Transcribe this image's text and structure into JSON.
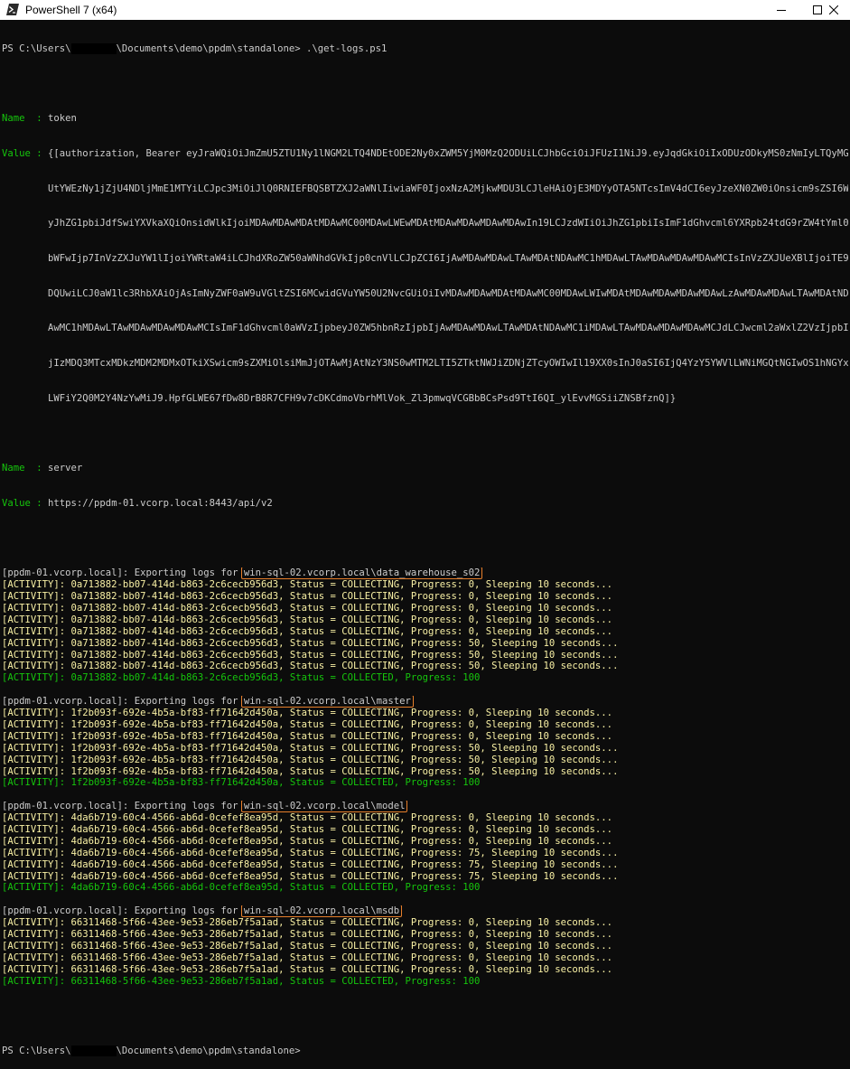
{
  "window": {
    "title": "PowerShell 7 (x64)",
    "icon": "powershell-icon",
    "controls": [
      "minimize-icon",
      "maximize-icon",
      "close-icon"
    ]
  },
  "prompt": {
    "pre": "PS C:\\Users\\",
    "post": "\\Documents\\demo\\ppdm\\standalone>",
    "command": " .\\get-logs.ps1"
  },
  "token": {
    "name_label": "Name  : ",
    "name_value": "token",
    "value_label": "Value : ",
    "value_lines": [
      "{[authorization, Bearer eyJraWQiOiJmZmU5ZTU1Ny1lNGM2LTQ4NDEtODE2Ny0xZWM5YjM0MzQ2ODUiLCJhbGciOiJFUzI1NiJ9.eyJqdGkiOiIxODUzODkyMS0zNmIyLTQyMG",
      "UtYWEzNy1jZjU4NDljMmE1MTYiLCJpc3MiOiJlQ0RNIEFBQSBTZXJ2aWNlIiwiaWF0IjoxNzA2MjkwMDU3LCJleHAiOjE3MDYyOTA5NTcsImV4dCI6eyJzeXN0ZW0iOnsicm9sZSI6W",
      "yJhZG1pbiJdfSwiYXVkaXQiOnsidWlkIjoiMDAwMDAwMDAtMDAwMC00MDAwLWEwMDAtMDAwMDAwMDAwMDAwIn19LCJzdWIiOiJhZG1pbiIsImF1dGhvcml6YXRpb24tdG9rZW4tYml0",
      "bWFwIjp7InVzZXJuYW1lIjoiYWRtaW4iLCJhdXRoZW50aWNhdGVkIjp0cnVlLCJpZCI6IjAwMDAwMDAwLTAwMDAtNDAwMC1hMDAwLTAwMDAwMDAwMDAwMCIsInVzZXJUeXBlIjoiTE9",
      "DQUwiLCJ0aW1lc3RhbXAiOjAsImNyZWF0aW9uVGltZSI6MCwidGVuYW50U2NvcGUiOiIvMDAwMDAwMDAtMDAwMC00MDAwLWIwMDAtMDAwMDAwMDAwMDAwLzAwMDAwMDAwLTAwMDAtND",
      "AwMC1hMDAwLTAwMDAwMDAwMDAwMCIsImF1dGhvcml0aWVzIjpbeyJ0ZW5hbnRzIjpbIjAwMDAwMDAwLTAwMDAtNDAwMC1iMDAwLTAwMDAwMDAwMDAwMCJdLCJwcml2aWxlZ2VzIjpbI",
      "jIzMDQ3MTcxMDkzMDM2MDMxOTkiXSwicm9sZXMiOlsiMmJjOTAwMjAtNzY3NS0wMTM2LTI5ZTktNWJiZDNjZTcyOWIwIl19XX0sInJ0aSI6IjQ4YzY5YWVlLWNiMGQtNGIwOS1hNGYx",
      "LWFiY2Q0M2Y4NzYwMiJ9.HpfGLWE67fDw8DrB8R7CFH9v7cDKCdmoVbrhMlVok_Zl3pmwqVCGBbBCsPsd9TtI6QI_ylEvvMGSiiZNSBfznQ]}"
    ]
  },
  "server": {
    "name_label": "Name  : ",
    "name_value": "server",
    "value_label": "Value : ",
    "value": "https://ppdm-01.vcorp.local:8443/api/v2"
  },
  "export_prefix": "[ppdm-01.vcorp.local]: Exporting logs for ",
  "exports": [
    {
      "database": "win-sql-02.vcorp.local\\data_warehouse_s02",
      "activities": [
        {
          "text": "[ACTIVITY]: 0a713882-bb07-414d-b863-2c6cecb956d3, Status = COLLECTING, Progress: 0, Sleeping 10 seconds...",
          "done": false
        },
        {
          "text": "[ACTIVITY]: 0a713882-bb07-414d-b863-2c6cecb956d3, Status = COLLECTING, Progress: 0, Sleeping 10 seconds...",
          "done": false
        },
        {
          "text": "[ACTIVITY]: 0a713882-bb07-414d-b863-2c6cecb956d3, Status = COLLECTING, Progress: 0, Sleeping 10 seconds...",
          "done": false
        },
        {
          "text": "[ACTIVITY]: 0a713882-bb07-414d-b863-2c6cecb956d3, Status = COLLECTING, Progress: 0, Sleeping 10 seconds...",
          "done": false
        },
        {
          "text": "[ACTIVITY]: 0a713882-bb07-414d-b863-2c6cecb956d3, Status = COLLECTING, Progress: 0, Sleeping 10 seconds...",
          "done": false
        },
        {
          "text": "[ACTIVITY]: 0a713882-bb07-414d-b863-2c6cecb956d3, Status = COLLECTING, Progress: 50, Sleeping 10 seconds...",
          "done": false
        },
        {
          "text": "[ACTIVITY]: 0a713882-bb07-414d-b863-2c6cecb956d3, Status = COLLECTING, Progress: 50, Sleeping 10 seconds...",
          "done": false
        },
        {
          "text": "[ACTIVITY]: 0a713882-bb07-414d-b863-2c6cecb956d3, Status = COLLECTING, Progress: 50, Sleeping 10 seconds...",
          "done": false
        },
        {
          "text": "[ACTIVITY]: 0a713882-bb07-414d-b863-2c6cecb956d3, Status = COLLECTED, Progress: 100",
          "done": true
        }
      ]
    },
    {
      "database": "win-sql-02.vcorp.local\\master",
      "activities": [
        {
          "text": "[ACTIVITY]: 1f2b093f-692e-4b5a-bf83-ff71642d450a, Status = COLLECTING, Progress: 0, Sleeping 10 seconds...",
          "done": false
        },
        {
          "text": "[ACTIVITY]: 1f2b093f-692e-4b5a-bf83-ff71642d450a, Status = COLLECTING, Progress: 0, Sleeping 10 seconds...",
          "done": false
        },
        {
          "text": "[ACTIVITY]: 1f2b093f-692e-4b5a-bf83-ff71642d450a, Status = COLLECTING, Progress: 0, Sleeping 10 seconds...",
          "done": false
        },
        {
          "text": "[ACTIVITY]: 1f2b093f-692e-4b5a-bf83-ff71642d450a, Status = COLLECTING, Progress: 50, Sleeping 10 seconds...",
          "done": false
        },
        {
          "text": "[ACTIVITY]: 1f2b093f-692e-4b5a-bf83-ff71642d450a, Status = COLLECTING, Progress: 50, Sleeping 10 seconds...",
          "done": false
        },
        {
          "text": "[ACTIVITY]: 1f2b093f-692e-4b5a-bf83-ff71642d450a, Status = COLLECTING, Progress: 50, Sleeping 10 seconds...",
          "done": false
        },
        {
          "text": "[ACTIVITY]: 1f2b093f-692e-4b5a-bf83-ff71642d450a, Status = COLLECTED, Progress: 100",
          "done": true
        }
      ]
    },
    {
      "database": "win-sql-02.vcorp.local\\model",
      "activities": [
        {
          "text": "[ACTIVITY]: 4da6b719-60c4-4566-ab6d-0cefef8ea95d, Status = COLLECTING, Progress: 0, Sleeping 10 seconds...",
          "done": false
        },
        {
          "text": "[ACTIVITY]: 4da6b719-60c4-4566-ab6d-0cefef8ea95d, Status = COLLECTING, Progress: 0, Sleeping 10 seconds...",
          "done": false
        },
        {
          "text": "[ACTIVITY]: 4da6b719-60c4-4566-ab6d-0cefef8ea95d, Status = COLLECTING, Progress: 0, Sleeping 10 seconds...",
          "done": false
        },
        {
          "text": "[ACTIVITY]: 4da6b719-60c4-4566-ab6d-0cefef8ea95d, Status = COLLECTING, Progress: 75, Sleeping 10 seconds...",
          "done": false
        },
        {
          "text": "[ACTIVITY]: 4da6b719-60c4-4566-ab6d-0cefef8ea95d, Status = COLLECTING, Progress: 75, Sleeping 10 seconds...",
          "done": false
        },
        {
          "text": "[ACTIVITY]: 4da6b719-60c4-4566-ab6d-0cefef8ea95d, Status = COLLECTING, Progress: 75, Sleeping 10 seconds...",
          "done": false
        },
        {
          "text": "[ACTIVITY]: 4da6b719-60c4-4566-ab6d-0cefef8ea95d, Status = COLLECTED, Progress: 100",
          "done": true
        }
      ]
    },
    {
      "database": "win-sql-02.vcorp.local\\msdb",
      "activities": [
        {
          "text": "[ACTIVITY]: 66311468-5f66-43ee-9e53-286eb7f5a1ad, Status = COLLECTING, Progress: 0, Sleeping 10 seconds...",
          "done": false
        },
        {
          "text": "[ACTIVITY]: 66311468-5f66-43ee-9e53-286eb7f5a1ad, Status = COLLECTING, Progress: 0, Sleeping 10 seconds...",
          "done": false
        },
        {
          "text": "[ACTIVITY]: 66311468-5f66-43ee-9e53-286eb7f5a1ad, Status = COLLECTING, Progress: 0, Sleeping 10 seconds...",
          "done": false
        },
        {
          "text": "[ACTIVITY]: 66311468-5f66-43ee-9e53-286eb7f5a1ad, Status = COLLECTING, Progress: 0, Sleeping 10 seconds...",
          "done": false
        },
        {
          "text": "[ACTIVITY]: 66311468-5f66-43ee-9e53-286eb7f5a1ad, Status = COLLECTING, Progress: 0, Sleeping 10 seconds...",
          "done": false
        },
        {
          "text": "[ACTIVITY]: 66311468-5f66-43ee-9e53-286eb7f5a1ad, Status = COLLECTED, Progress: 100",
          "done": true
        }
      ]
    }
  ],
  "colors": {
    "background": "#0c0c0c",
    "text": "#cccccc",
    "activity": "#f9f1a5",
    "success": "#16c60c",
    "highlight_box": "#e77f2b"
  }
}
